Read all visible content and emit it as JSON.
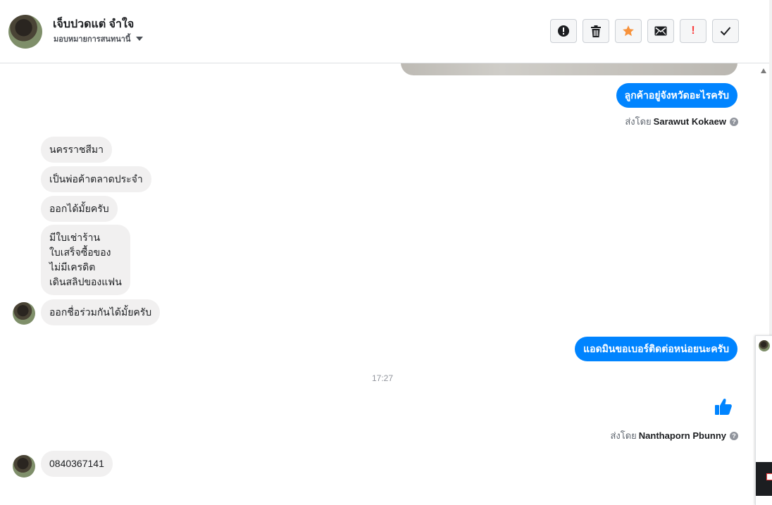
{
  "header": {
    "contact_name": "เจ็บปวดแต่ จำใจ",
    "assign_label": "มอบหมายการสนทนานี้"
  },
  "toolbar": {
    "buttons": [
      {
        "name": "spam",
        "icon": "exclamation-circle-icon"
      },
      {
        "name": "delete",
        "icon": "trash-icon"
      },
      {
        "name": "star",
        "icon": "star-icon",
        "color": "#f7923b"
      },
      {
        "name": "mark-unread",
        "icon": "envelope-icon"
      },
      {
        "name": "priority",
        "icon": "exclamation-icon",
        "color": "#fa3e3e"
      },
      {
        "name": "done",
        "icon": "check-icon"
      }
    ]
  },
  "messages": {
    "out_1": "ลูกค้าอยู่จังหวัดอะไรครับ",
    "sent_by_1": {
      "prefix": "ส่งโดย",
      "name": "Sarawut Kokaew"
    },
    "in_1": "นครราชสีมา",
    "in_2": "เป็นพ่อค้าตลาดประจำ",
    "in_3": "ออกได้มั้ยครับ",
    "in_4": [
      "มีใบเช่าร้าน",
      "ใบเสร็จซื้อของ",
      "ไม่มีเครดิต",
      "เดินสลิปของแฟน"
    ],
    "in_5": "ออกชื่อร่วมกันได้มั้ยครับ",
    "out_2": "แอดมินขอเบอร์ติดต่อหน่อยนะครับ",
    "timestamp": "17:27",
    "sent_by_2": {
      "prefix": "ส่งโดย",
      "name": "Nanthaporn Pbunny"
    },
    "in_6": "0840367141"
  },
  "colors": {
    "outgoing_bubble": "#0084ff",
    "incoming_bubble": "#f1f0f0",
    "like_icon": "#0084ff"
  }
}
